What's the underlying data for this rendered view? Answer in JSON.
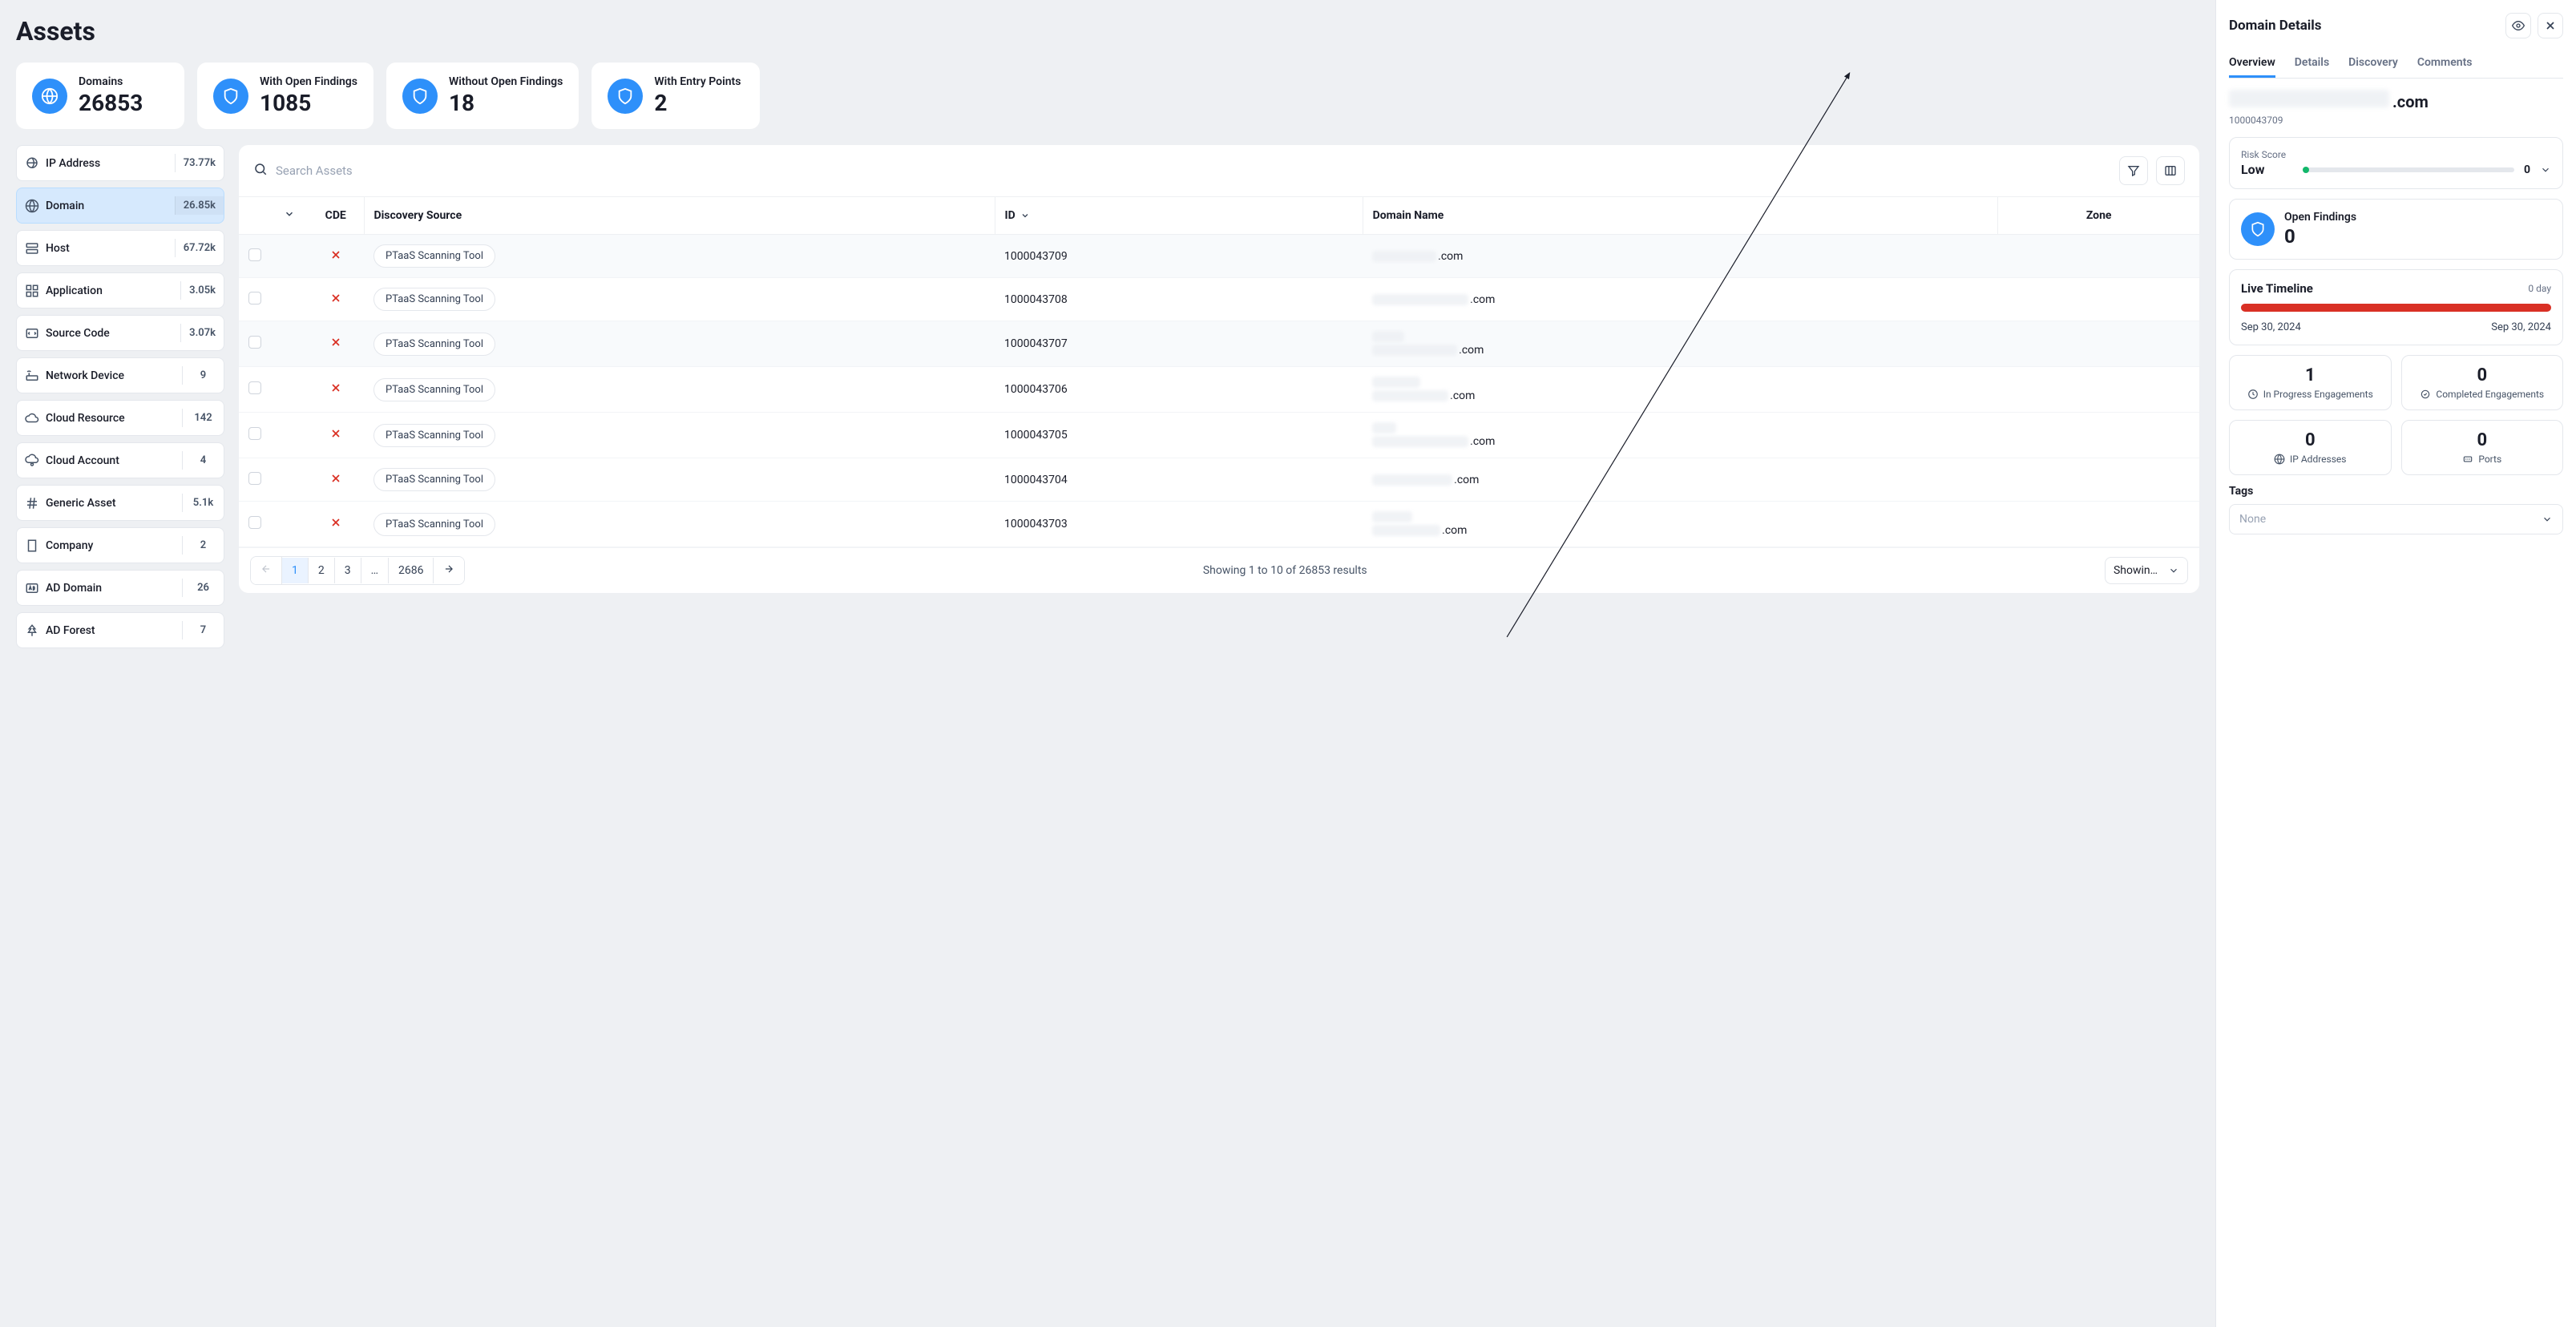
{
  "page": {
    "title": "Assets"
  },
  "cards": [
    {
      "label": "Domains",
      "value": "26853",
      "icon": "globe"
    },
    {
      "label": "With Open Findings",
      "value": "1085",
      "icon": "shield"
    },
    {
      "label": "Without Open Findings",
      "value": "18",
      "icon": "shield"
    },
    {
      "label": "With Entry Points",
      "value": "2",
      "icon": "shield"
    }
  ],
  "filters": [
    {
      "label": "IP Address",
      "count": "73.77k",
      "icon": "globe-pin"
    },
    {
      "label": "Domain",
      "count": "26.85k",
      "icon": "globe",
      "active": true
    },
    {
      "label": "Host",
      "count": "67.72k",
      "icon": "server"
    },
    {
      "label": "Application",
      "count": "3.05k",
      "icon": "grid"
    },
    {
      "label": "Source Code",
      "count": "3.07k",
      "icon": "code"
    },
    {
      "label": "Network Device",
      "count": "9",
      "icon": "router"
    },
    {
      "label": "Cloud Resource",
      "count": "142",
      "icon": "cloud"
    },
    {
      "label": "Cloud Account",
      "count": "4",
      "icon": "cloud-user"
    },
    {
      "label": "Generic Asset",
      "count": "5.1k",
      "icon": "hash"
    },
    {
      "label": "Company",
      "count": "2",
      "icon": "building"
    },
    {
      "label": "AD Domain",
      "count": "26",
      "icon": "ad"
    },
    {
      "label": "AD Forest",
      "count": "7",
      "icon": "tree"
    }
  ],
  "search": {
    "placeholder": "Search Assets"
  },
  "columns": {
    "cde": "CDE",
    "discovery_source": "Discovery Source",
    "id": "ID",
    "domain_name": "Domain Name",
    "zone": "Zone"
  },
  "rows": [
    {
      "id": "1000043709",
      "source": "PTaaS Scanning Tool",
      "domain_suffix": ".com",
      "blur_widths": [
        80
      ],
      "selected": true
    },
    {
      "id": "1000043708",
      "source": "PTaaS Scanning Tool",
      "domain_suffix": ".com",
      "blur_widths": [
        120
      ]
    },
    {
      "id": "1000043707",
      "source": "PTaaS Scanning Tool",
      "domain_suffix": ".com",
      "blur_widths": [
        40,
        106
      ],
      "selected": true
    },
    {
      "id": "1000043706",
      "source": "PTaaS Scanning Tool",
      "domain_suffix": ".com",
      "blur_widths": [
        60,
        95
      ]
    },
    {
      "id": "1000043705",
      "source": "PTaaS Scanning Tool",
      "domain_suffix": ".com",
      "blur_widths": [
        30,
        120
      ]
    },
    {
      "id": "1000043704",
      "source": "PTaaS Scanning Tool",
      "domain_suffix": ".com",
      "blur_widths": [
        100
      ]
    },
    {
      "id": "1000043703",
      "source": "PTaaS Scanning Tool",
      "domain_suffix": ".com",
      "blur_widths": [
        50,
        85
      ]
    }
  ],
  "pagination": {
    "pages": [
      "1",
      "2",
      "3",
      "…",
      "2686"
    ],
    "active_index": 0,
    "summary": "Showing 1 to 10 of 26853 results",
    "showing_label": "Showing…"
  },
  "details": {
    "title": "Domain Details",
    "tabs": [
      "Overview",
      "Details",
      "Discovery",
      "Comments"
    ],
    "active_tab": 0,
    "domain_suffix": ".com",
    "domain_id": "1000043709",
    "risk": {
      "label": "Risk Score",
      "level": "Low",
      "value": "0"
    },
    "open_findings": {
      "label": "Open Findings",
      "value": "0"
    },
    "timeline": {
      "title": "Live Timeline",
      "days": "0 day",
      "start": "Sep 30, 2024",
      "end": "Sep 30, 2024"
    },
    "metrics": [
      {
        "value": "1",
        "label": "In Progress Engagements",
        "icon": "clock"
      },
      {
        "value": "0",
        "label": "Completed Engagements",
        "icon": "badge"
      },
      {
        "value": "0",
        "label": "IP Addresses",
        "icon": "globe"
      },
      {
        "value": "0",
        "label": "Ports",
        "icon": "port"
      }
    ],
    "tags": {
      "title": "Tags",
      "placeholder": "None"
    }
  }
}
